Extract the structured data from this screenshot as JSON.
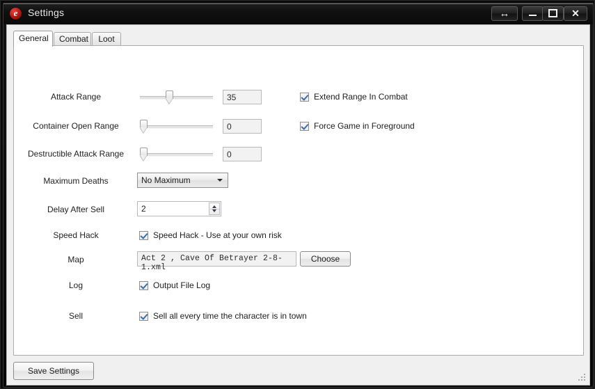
{
  "window": {
    "title": "Settings",
    "icon": "app-e-icon",
    "icon_glyph": "e",
    "buttons": {
      "swap": "↔",
      "minimize": "minimize",
      "maximize": "maximize",
      "close": "✕"
    }
  },
  "tabs": [
    {
      "label": "General",
      "active": true
    },
    {
      "label": "Combat",
      "active": false
    },
    {
      "label": "Loot",
      "active": false
    }
  ],
  "form": {
    "rows": [
      {
        "label": "Attack Range",
        "value": "35"
      },
      {
        "label": "Container Open Range",
        "value": "0"
      },
      {
        "label": "Destructible Attack Range",
        "value": "0"
      },
      {
        "label": "Maximum Deaths",
        "value": "No Maximum"
      },
      {
        "label": "Delay After Sell",
        "value": "2"
      },
      {
        "label": "Speed Hack",
        "value": "Speed Hack - Use at your own risk"
      },
      {
        "label": "Map",
        "value": "Act 2 , Cave Of Betrayer 2-8-1.xml"
      },
      {
        "label": "Log",
        "value": "Output File Log"
      },
      {
        "label": "Sell",
        "value": "Sell all every time the character is in town"
      }
    ],
    "checkboxes": [
      {
        "label": "Extend Range In Combat",
        "checked": true
      },
      {
        "label": "Force Game in Foreground",
        "checked": true
      }
    ],
    "choose_button": "Choose"
  },
  "footer": {
    "save_label": "Save Settings"
  },
  "colors": {
    "accent_check": "#3b6ea5",
    "titlebar": "#0f0f0f",
    "panel": "#ffffff",
    "client": "#f0f0f0"
  }
}
